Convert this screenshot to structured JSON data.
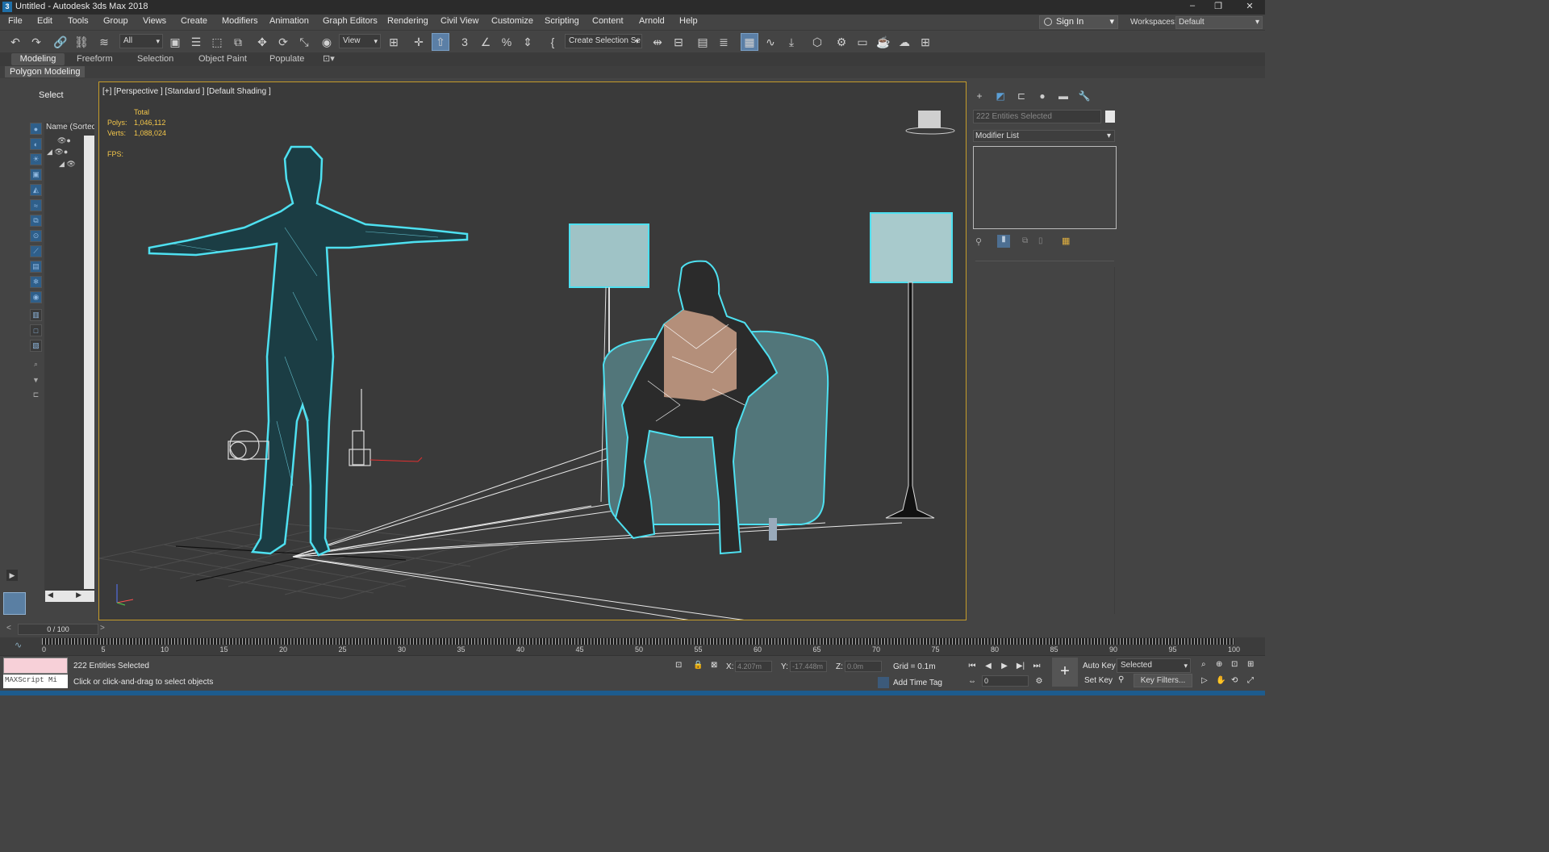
{
  "window": {
    "title": "Untitled - Autodesk 3ds Max 2018",
    "icon_letter": "3"
  },
  "menu": [
    "File",
    "Edit",
    "Tools",
    "Group",
    "Views",
    "Create",
    "Modifiers",
    "Animation",
    "Graph Editors",
    "Rendering",
    "Civil View",
    "Customize",
    "Scripting",
    "Content",
    "Arnold",
    "Help"
  ],
  "account": {
    "sign_in": "Sign In",
    "workspaces_label": "Workspaces:",
    "workspace": "Default"
  },
  "toolbar": {
    "filter": "All",
    "view": "View",
    "selection_set": "Create Selection Se"
  },
  "ribbon": {
    "tabs": [
      "Modeling",
      "Freeform",
      "Selection",
      "Object Paint",
      "Populate"
    ],
    "sub": "Polygon Modeling"
  },
  "explorer": {
    "select_label": "Select",
    "column_header": "Name (Sorted A"
  },
  "viewport": {
    "label": "[+] [Perspective ] [Standard ] [Default Shading ]",
    "stats": {
      "total": "Total",
      "polys_label": "Polys:",
      "polys": "1,046,112",
      "verts_label": "Verts:",
      "verts": "1,088,024",
      "fps_label": "FPS:"
    }
  },
  "command_panel": {
    "selection": "222 Entities Selected",
    "modifier_list": "Modifier List"
  },
  "timeline": {
    "frame": "0 / 100",
    "ticks": [
      "0",
      "5",
      "10",
      "15",
      "20",
      "25",
      "30",
      "35",
      "40",
      "45",
      "50",
      "55",
      "60",
      "65",
      "70",
      "75",
      "80",
      "85",
      "90",
      "95",
      "100"
    ]
  },
  "status": {
    "maxscript": "MAXScript Mi",
    "selected": "222 Entities Selected",
    "prompt": "Click or click-and-drag to select objects",
    "x_label": "X:",
    "x": "4.207m",
    "y_label": "Y:",
    "y": "-17.448m",
    "z_label": "Z:",
    "z": "0.0m",
    "grid": "Grid = 0.1m",
    "add_time_tag": "Add Time Tag",
    "auto_key": "Auto Key",
    "set_key": "Set Key",
    "key_mode": "Selected",
    "key_filters": "Key Filters...",
    "frame_field": "0"
  },
  "colors": {
    "accent": "#c59c2a",
    "wire_cyan": "#4ee0f0",
    "titlebar": "#2b2b2b",
    "footer": "#1d5c8e"
  }
}
